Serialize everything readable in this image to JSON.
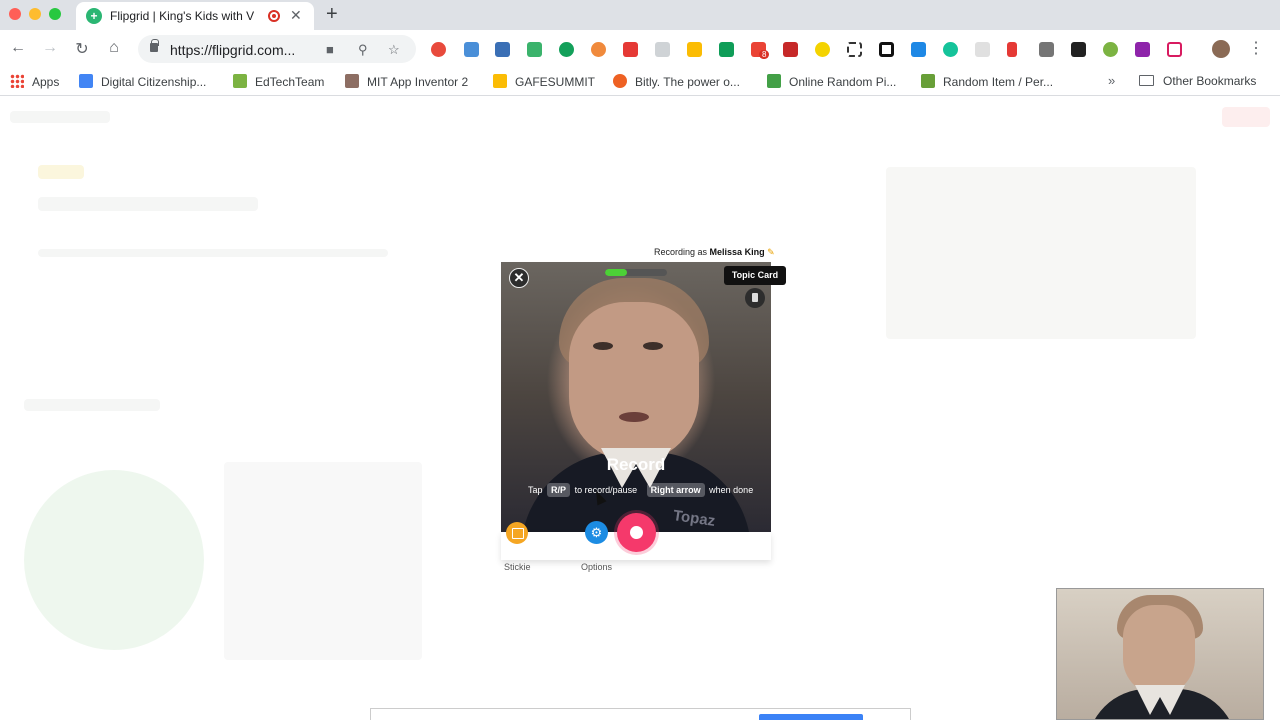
{
  "browser": {
    "tab_title": "Flipgrid | King's Kids with V",
    "tab_favicon_letter": "+",
    "url": "https://flipgrid.com...",
    "bookmarks": [
      {
        "label": "Apps",
        "color": "#ea4335"
      },
      {
        "label": "Digital Citizenship...",
        "color": "#4285f4"
      },
      {
        "label": "EdTechTeam",
        "color": "#7cb342"
      },
      {
        "label": "MIT App Inventor 2",
        "color": "#8d6e63"
      },
      {
        "label": "GAFESUMMIT",
        "color": "#fbbc04"
      },
      {
        "label": "Bitly. The power o...",
        "color": "#ee6123"
      },
      {
        "label": "Online Random Pi...",
        "color": "#43a047"
      },
      {
        "label": "Random Item / Per...",
        "color": "#689f38"
      }
    ],
    "bookmarks_overflow": "»",
    "other_bookmarks": "Other Bookmarks",
    "mail_badge": "8"
  },
  "recorder": {
    "recording_as_prefix": "Recording as",
    "recording_as_name": "Melissa King",
    "topic_card_label": "Topic Card",
    "close_glyph": "✕",
    "record_title": "Record",
    "hint_tap": "Tap",
    "hint_key_rp": "R/P",
    "hint_to": "to record/pause",
    "hint_key_right": "Right arrow",
    "hint_done": "when done",
    "watermark": "Topaz",
    "progress_fraction": 0.35,
    "stickie_label": "Stickie",
    "options_label": "Options",
    "options_glyph": "⚙",
    "accent_record": "#f5396b",
    "accent_options": "#1c8ce3",
    "accent_stickie": "#f5a623"
  }
}
